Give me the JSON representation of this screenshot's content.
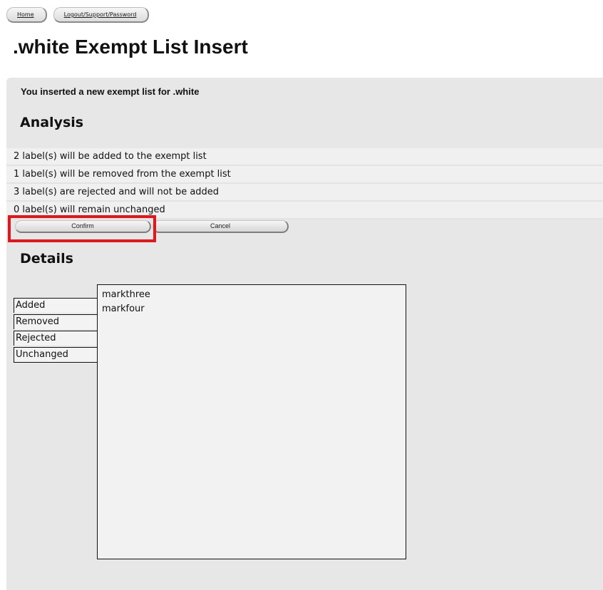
{
  "nav": {
    "home": "Home",
    "logout": "Logout/Support/Password"
  },
  "page": {
    "title": ".white Exempt List Insert"
  },
  "message": "You inserted a new exempt list for .white",
  "analysis": {
    "title": "Analysis",
    "rows": [
      "2 label(s) will be added to the exempt list",
      "1 label(s) will be removed from the exempt list",
      "3 label(s) are rejected and will not be added",
      "0 label(s) will remain unchanged"
    ]
  },
  "buttons": {
    "confirm": "Confirm",
    "cancel": "Cancel"
  },
  "details": {
    "title": "Details",
    "categories": [
      "Added",
      "Removed",
      "Rejected",
      "Unchanged"
    ],
    "items": [
      "markthree",
      "markfour"
    ]
  },
  "colors": {
    "highlight": "#e3161b",
    "panel": "#e7e7e7"
  }
}
